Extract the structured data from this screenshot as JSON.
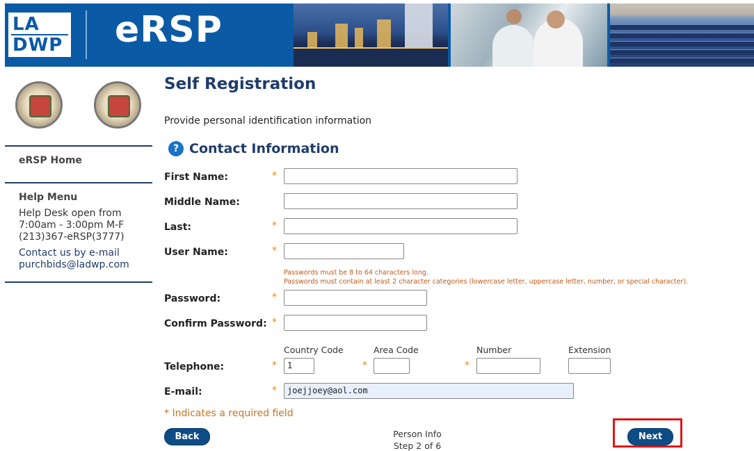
{
  "header": {
    "logo_top": "LA",
    "logo_bottom": "DWP",
    "brand": "eRSP"
  },
  "sidebar": {
    "home_link": "eRSP Home",
    "help_menu_title": "Help Menu",
    "help_line1": "Help Desk open from",
    "help_line2": "7:00am - 3:00pm M-F",
    "help_line3": "(213)367-eRSP(3777)",
    "contact_line1": "Contact us by e-mail",
    "contact_line2": "purchbids@ladwp.com"
  },
  "main": {
    "title": "Self Registration",
    "subtitle": "Provide personal identification information",
    "help_icon": "?",
    "section_title": "Contact Information"
  },
  "form": {
    "first_name_label": "First Name:",
    "middle_name_label": "Middle Name:",
    "last_label": "Last:",
    "user_name_label": "User Name:",
    "password_note1": "Passwords must be 8 to 64 characters long.",
    "password_note2": "Passwords must contain at least 2 character categories (lowercase letter, uppercase letter, number, or special character).",
    "password_label": "Password:",
    "confirm_password_label": "Confirm Password:",
    "telephone_label": "Telephone:",
    "country_code_header": "Country Code",
    "area_code_header": "Area Code",
    "number_header": "Number",
    "extension_header": "Extension",
    "country_code_value": "1",
    "email_label": "E-mail:",
    "email_value": "joejjoey@aol.com",
    "required_star": "*",
    "required_note": "* Indicates a required field"
  },
  "footer": {
    "back_label": "Back",
    "next_label": "Next",
    "step_title": "Person Info",
    "step_count": "Step 2 of 6"
  },
  "colors": {
    "brand_blue": "#0b5aa6",
    "heading_navy": "#1f3c6b",
    "required_orange": "#e08a1e",
    "highlight_red": "#e01515"
  }
}
